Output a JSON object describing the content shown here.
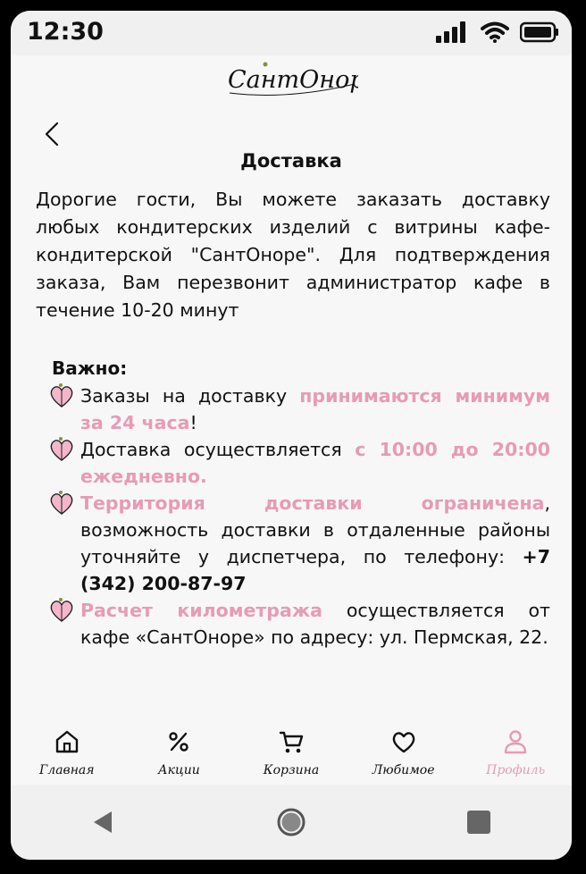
{
  "status_bar": {
    "time": "12:30",
    "icons": [
      "signal-icon",
      "wifi-icon",
      "battery-icon"
    ]
  },
  "brand": {
    "logo_text": "СантОноре"
  },
  "header": {
    "back_icon": "chevron-left-icon",
    "title": "Доставка"
  },
  "content": {
    "intro": "Дорогие гости, Вы можете заказать доставку любых кондитерских изделий с витрины кафе-кондитерской \"СантОноре\". Для подтверждения заказа, Вам перезвонит администратор кафе в течение 10-20 минут",
    "important_label": "Важно:",
    "items": [
      {
        "text_before": "Заказы на доставку ",
        "highlight": "принимаются минимум за 24 часа",
        "text_after": "!"
      },
      {
        "text_before": "Доставка осуществляется ",
        "highlight": "с 10:00 до 20:00 ежедневно.",
        "text_after": ""
      },
      {
        "text_before": "",
        "highlight": "Территория доставки ограничена",
        "text_after": ", возможность доставки в отдаленные районы уточняйте у диспетчера, по телефону: ",
        "phone": "+7 (342) 200-87-97"
      },
      {
        "text_before": "",
        "highlight": "Расчет километража",
        "text_after": " осуществляется от кафе «СантОноре» по адресу: ул. Пермская, 22."
      }
    ]
  },
  "tabbar": {
    "tabs": [
      {
        "label": "Главная",
        "icon": "home-icon"
      },
      {
        "label": "Акции",
        "icon": "percent-icon"
      },
      {
        "label": "Корзина",
        "icon": "cart-icon"
      },
      {
        "label": "Любимое",
        "icon": "heart-icon"
      },
      {
        "label": "Профиль",
        "icon": "user-icon",
        "active": true
      }
    ]
  },
  "colors": {
    "accent": "#e79bb5",
    "text": "#111111",
    "background": "#f7f7f7"
  },
  "navbar": {
    "icons": [
      "back-nav-icon",
      "home-nav-icon",
      "recents-nav-icon"
    ]
  }
}
